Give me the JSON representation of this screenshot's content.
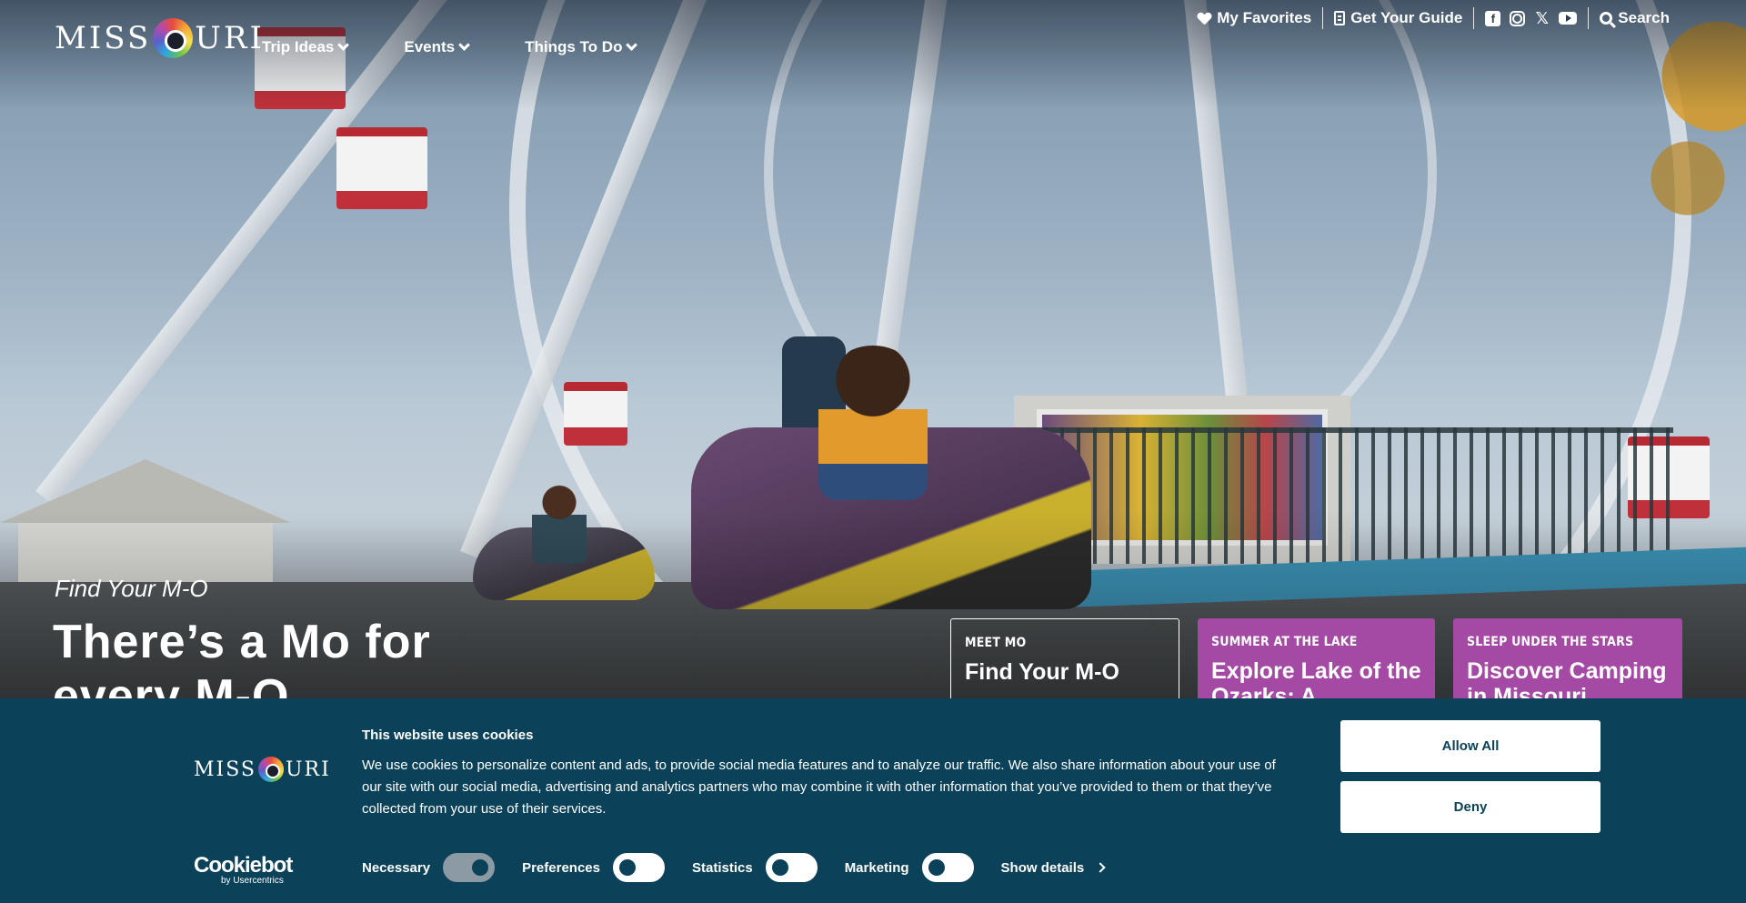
{
  "brand": {
    "logo_text_left": "MISS",
    "logo_text_right": "URI"
  },
  "nav": {
    "items": [
      {
        "label": "Trip Ideas"
      },
      {
        "label": "Events"
      },
      {
        "label": "Things To Do"
      }
    ]
  },
  "utility": {
    "favorites": "My Favorites",
    "guide": "Get Your Guide",
    "social": [
      "facebook-icon",
      "instagram-icon",
      "x-icon",
      "youtube-icon"
    ],
    "search": "Search"
  },
  "hero": {
    "eyebrow": "Find Your M-O",
    "headline": "There’s a Mo for every M-O"
  },
  "cards": [
    {
      "kicker": "MEET MO",
      "title": "Find Your M-O"
    },
    {
      "kicker": "SUMMER AT THE LAKE",
      "title": "Explore Lake of the Ozarks: A"
    },
    {
      "kicker": "SLEEP UNDER THE STARS",
      "title": "Discover Camping in Missouri"
    }
  ],
  "cookie_banner": {
    "logo_text_left": "MISS",
    "logo_text_right": "URI",
    "title": "This website uses cookies",
    "body": "We use cookies to personalize content and ads, to provide social media features and to analyze our traffic. We also share information about your use of our site with our social media, advertising and analytics partners who may combine it with other information that you’ve provided to them or that they’ve collected from your use of their services.",
    "allow_all": "Allow All",
    "deny": "Deny",
    "toggles": [
      {
        "label": "Necessary",
        "checked": true
      },
      {
        "label": "Preferences",
        "checked": false
      },
      {
        "label": "Statistics",
        "checked": false
      },
      {
        "label": "Marketing",
        "checked": false
      }
    ],
    "show_details": "Show details",
    "provider": "Cookiebot",
    "provider_sub": "by Usercentrics"
  },
  "colors": {
    "banner_bg": "#0b4259",
    "card_purple": "#a54aa4"
  }
}
